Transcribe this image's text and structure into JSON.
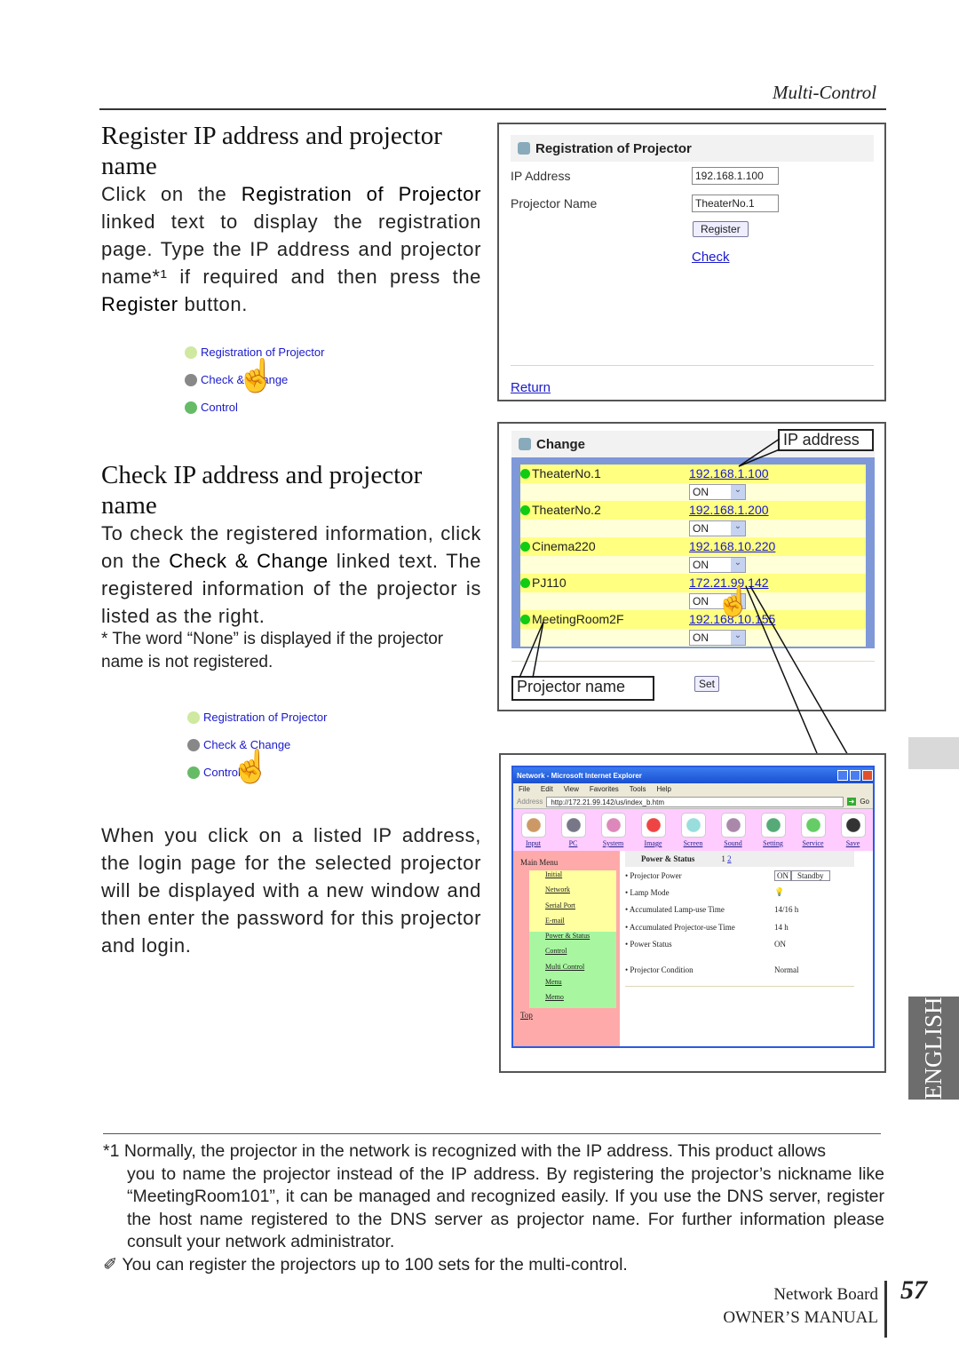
{
  "header": {
    "section": "Multi-Control"
  },
  "section1": {
    "title": "Register IP address and projector name",
    "body": [
      "Click on the ",
      "Registration of Projector",
      " linked text to display the registration page. Type the IP address and projector name*¹ if required and then press the ",
      "Register",
      " button."
    ],
    "menu": [
      "Registration of Projector",
      "Check & Change",
      "Control"
    ]
  },
  "section2": {
    "title": "Check IP address and projector name",
    "body": [
      "To check the registered information, click on the ",
      "Check & Change",
      " linked text. The registered information of the projector is listed as the right."
    ],
    "note": "* The word “None” is displayed if the projector name is not registered.",
    "menu": [
      "Registration of Projector",
      "Check & Change",
      "Control"
    ],
    "body2": "When you click on a listed IP address, the login page for the selected projector will be displayed with a new window and then enter the password for this projector and login."
  },
  "registration": {
    "title": "Registration of Projector",
    "ip_label": "IP Address",
    "ip_value": "192.168.1.100",
    "name_label": "Projector Name",
    "name_value": "TheaterNo.1",
    "register": "Register",
    "check": "Check",
    "return": "Return"
  },
  "change": {
    "title": "Change",
    "set": "Set",
    "callout_ip": "IP address",
    "callout_name": "Projector name",
    "rows": [
      {
        "name": "TheaterNo.1",
        "ip": "192.168.1.100",
        "state": "ON"
      },
      {
        "name": "TheaterNo.2",
        "ip": "192.168.1.200",
        "state": "ON"
      },
      {
        "name": "Cinema220",
        "ip": "192.168.10.220",
        "state": "ON"
      },
      {
        "name": "PJ110",
        "ip": "172.21.99.142",
        "state": "ON"
      },
      {
        "name": "MeetingRoom2F",
        "ip": "192.168.10.155",
        "state": "ON"
      }
    ]
  },
  "browser": {
    "title": "Network - Microsoft Internet Explorer",
    "menu": [
      "File",
      "Edit",
      "View",
      "Favorites",
      "Tools",
      "Help"
    ],
    "address_label": "Address",
    "url": "http://172.21.99.142/us/index_b.htm",
    "go": "Go",
    "tools": [
      "Input",
      "PC",
      "System",
      "Image",
      "Screen",
      "Sound",
      "Setting",
      "Service",
      "Save"
    ],
    "side_title": "Main Menu",
    "side_yellow": [
      "Initial",
      "Network",
      "Serial Port",
      "E-mail"
    ],
    "side_green": [
      "Power & Status",
      "Control",
      "Multi Control",
      "Menu",
      "Memo"
    ],
    "top": "Top",
    "main_title": "Power & Status",
    "pages": [
      "1",
      "2"
    ],
    "rows": [
      {
        "k": "Projector Power",
        "v": ""
      },
      {
        "k": "Lamp Mode",
        "v": ""
      },
      {
        "k": "Accumulated Lamp-use Time",
        "v": "14/16 h"
      },
      {
        "k": "Accumulated Projector-use Time",
        "v": "14 h"
      },
      {
        "k": "Power Status",
        "v": "ON"
      },
      {
        "k": "Projector Condition",
        "v": "Normal"
      }
    ],
    "on": "ON",
    "standby": "Standby"
  },
  "tab": "ENGLISH",
  "footnote": {
    "first": "*1 Normally, the projector in the network is recognized with the IP address. This product allows",
    "rest": "you to name the projector instead of the IP address. By registering the projector’s nickname like “MeetingRoom101”, it can be managed and recognized easily. If you use the DNS server, register the host name registered to the DNS server as projector name. For further information please consult your network administrator.",
    "tip": "✐ You can register the projectors up to 100 sets for the multi-control."
  },
  "footer": {
    "line1": "Network Board",
    "line2": "OWNER’S MANUAL",
    "page": "57"
  }
}
